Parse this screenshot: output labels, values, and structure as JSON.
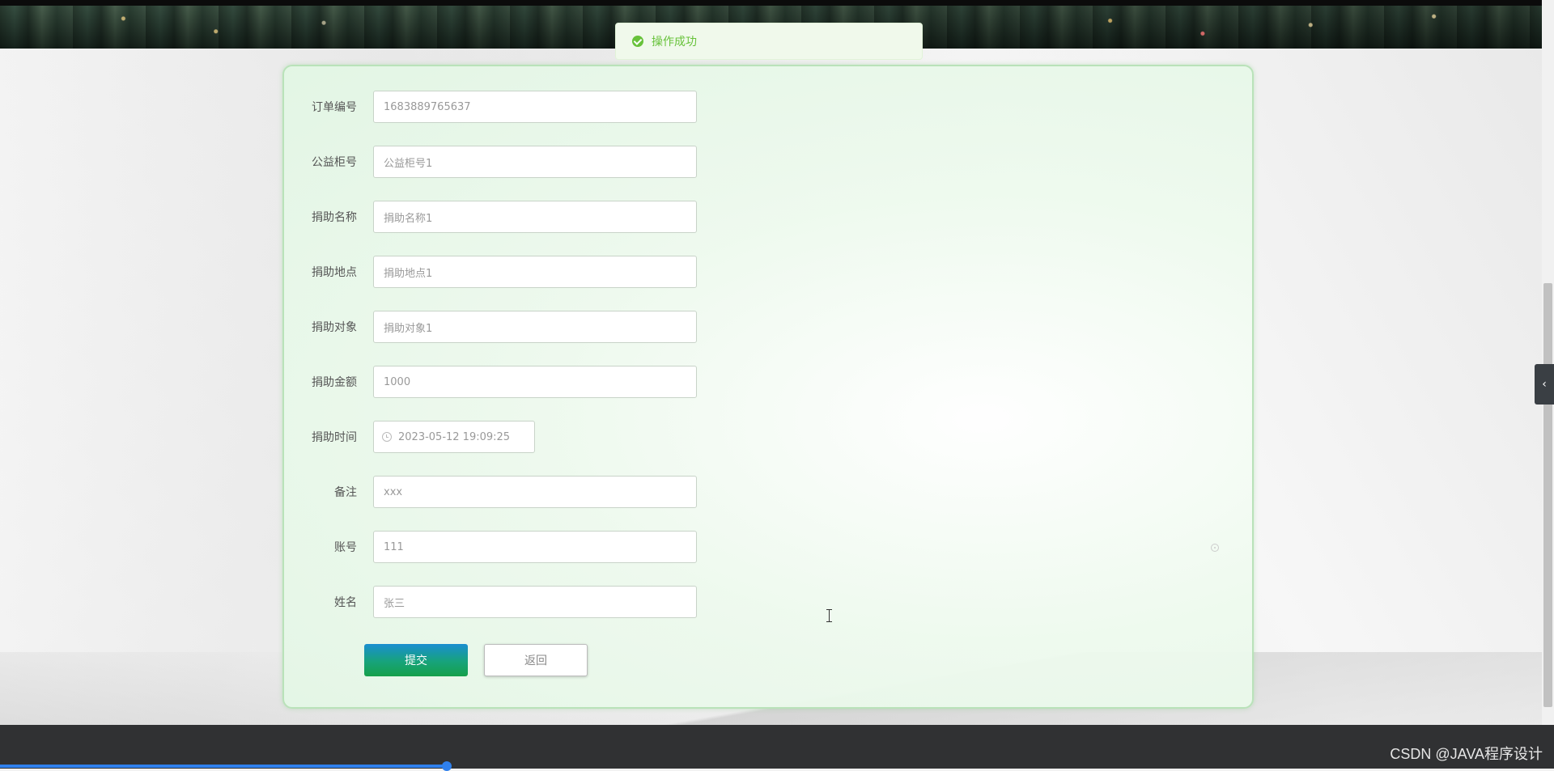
{
  "toast": {
    "message": "操作成功"
  },
  "form": {
    "fields": [
      {
        "label": "订单编号",
        "value": "1683889765637"
      },
      {
        "label": "公益柜号",
        "value": "公益柜号1"
      },
      {
        "label": "捐助名称",
        "value": "捐助名称1"
      },
      {
        "label": "捐助地点",
        "value": "捐助地点1"
      },
      {
        "label": "捐助对象",
        "value": "捐助对象1"
      },
      {
        "label": "捐助金额",
        "value": "1000"
      },
      {
        "label": "捐助时间",
        "value": "2023-05-12 19:09:25"
      },
      {
        "label": "备注",
        "value": "xxx"
      },
      {
        "label": "账号",
        "value": "111"
      },
      {
        "label": "姓名",
        "value": "张三"
      }
    ],
    "submit_label": "提交",
    "back_label": "返回"
  },
  "panel_toggle": {
    "glyph": "‹"
  },
  "watermark": "CSDN @JAVA程序设计",
  "colors": {
    "accent_green": "#16a04a",
    "accent_blue": "#1a8ed1",
    "toast_green": "#67c23a"
  }
}
